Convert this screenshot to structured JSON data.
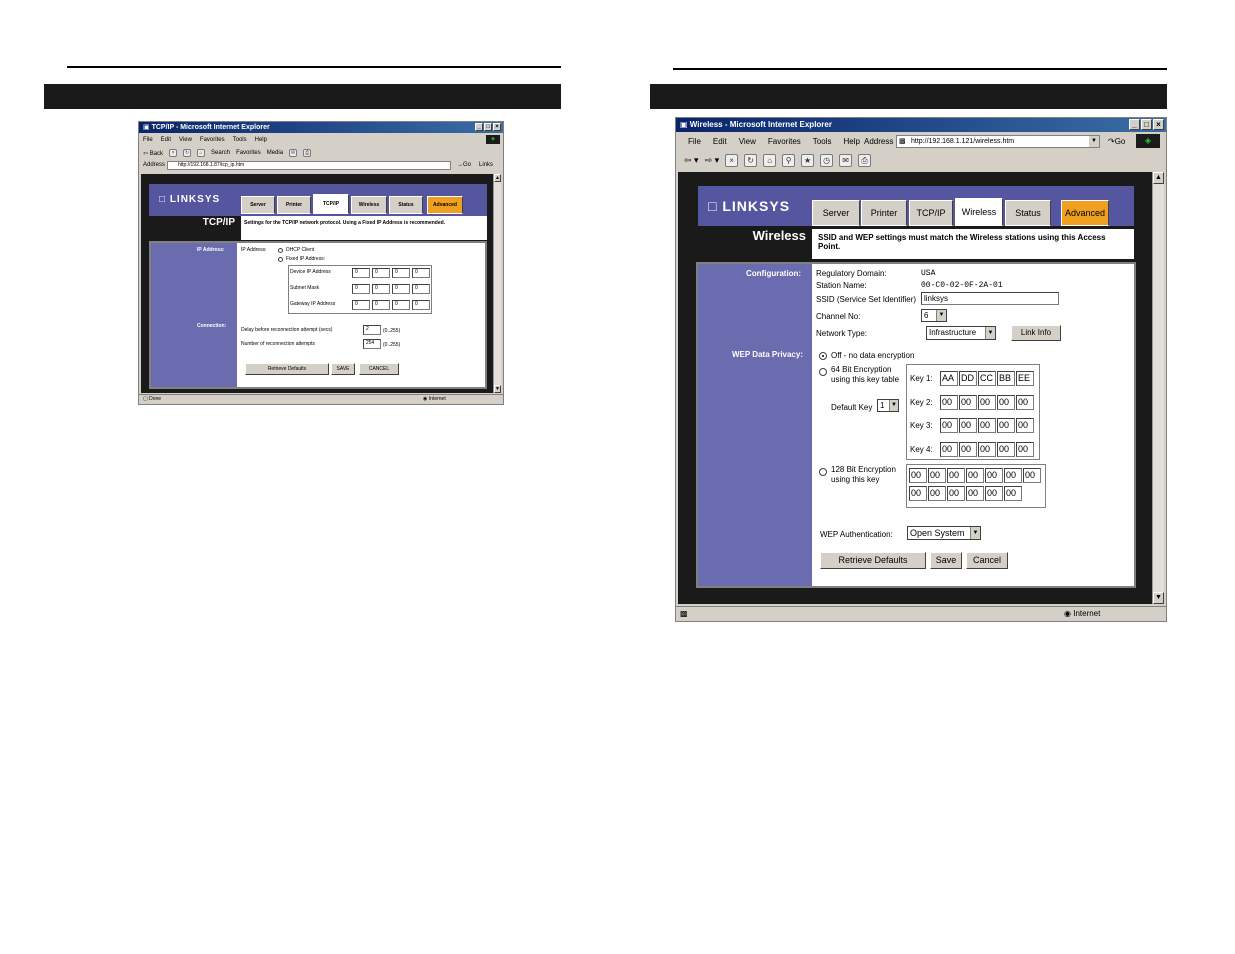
{
  "left_window": {
    "title": "TCP/IP - Microsoft Internet Explorer",
    "menu": [
      "File",
      "Edit",
      "View",
      "Favorites",
      "Tools",
      "Help"
    ],
    "toolbar": [
      "Back",
      "Search",
      "Favorites",
      "Media"
    ],
    "address_label": "Address",
    "address": "http://192.168.1.87/tcp_ip.htm",
    "go": "Go",
    "links": "Links",
    "logo": "LINKSYS",
    "tabs": [
      "Server",
      "Printer",
      "TCP/IP",
      "Wireless",
      "Status",
      "Advanced"
    ],
    "page_title": "TCP/IP",
    "notice": "Settings for the TCP/IP network protocol. Using a Fixed IP Address is recommended.",
    "ip_label": "IP Address:",
    "ip_field_label": "IP Address:",
    "dhcp": "DHCP Client",
    "fixed": "Fixed IP Address:",
    "device_ip": "Device IP Address",
    "subnet": "Subnet Mask",
    "gateway": "Gateway IP Address",
    "octet": "0",
    "connection_label": "Connection:",
    "delay_label": "Delay before reconnection attempt (secs)",
    "delay_value": "2",
    "delay_range": "(0..255)",
    "attempts_label": "Number of reconnection attempts",
    "attempts_value": "254",
    "attempts_range": "(0..255)",
    "retrieve": "Retrieve Defaults",
    "save": "SAVE",
    "cancel": "CANCEL",
    "status_left": "Done",
    "status_right": "Internet"
  },
  "right_window": {
    "title": "Wireless - Microsoft Internet Explorer",
    "menu": [
      "File",
      "Edit",
      "View",
      "Favorites",
      "Tools",
      "Help"
    ],
    "address_label": "Address",
    "address": "http://192.168.1.121/wireless.htm",
    "go": "Go",
    "logo": "LINKSYS",
    "tabs": [
      "Server",
      "Printer",
      "TCP/IP",
      "Wireless",
      "Status",
      "Advanced"
    ],
    "page_title": "Wireless",
    "notice": "SSID and WEP settings must match the Wireless stations using this Access Point.",
    "configuration_label": "Configuration:",
    "regulatory_label": "Regulatory Domain:",
    "regulatory_value": "USA",
    "station_label": "Station Name:",
    "station_value": "00-C0-02-0F-2A-01",
    "ssid_label": "SSID (Service Set Identifier)",
    "ssid_value": "linksys",
    "channel_label": "Channel No:",
    "channel_value": "6",
    "network_label": "Network Type:",
    "network_value": "Infrastructure",
    "link_info": "Link Info",
    "wep_label": "WEP Data Privacy:",
    "off_option": "Off - no data encryption",
    "bit64_line1": "64 Bit Encryption",
    "bit64_line2": "using this key table",
    "default_key_label": "Default Key",
    "default_key_value": "1",
    "key1_label": "Key 1:",
    "key2_label": "Key 2:",
    "key3_label": "Key 3:",
    "key4_label": "Key 4:",
    "key1": [
      "AA",
      "DD",
      "CC",
      "BB",
      "EE"
    ],
    "key2": [
      "00",
      "00",
      "00",
      "00",
      "00"
    ],
    "key3": [
      "00",
      "00",
      "00",
      "00",
      "00"
    ],
    "key4": [
      "00",
      "00",
      "00",
      "00",
      "00"
    ],
    "bit128_line1": "128 Bit Encryption",
    "bit128_line2": "using this key",
    "key128_row1": [
      "00",
      "00",
      "00",
      "00",
      "00",
      "00",
      "00"
    ],
    "key128_row2": [
      "00",
      "00",
      "00",
      "00",
      "00",
      "00"
    ],
    "auth_label": "WEP Authentication:",
    "auth_value": "Open System",
    "retrieve": "Retrieve Defaults",
    "save": "Save",
    "cancel": "Cancel",
    "status_right": "Internet"
  }
}
